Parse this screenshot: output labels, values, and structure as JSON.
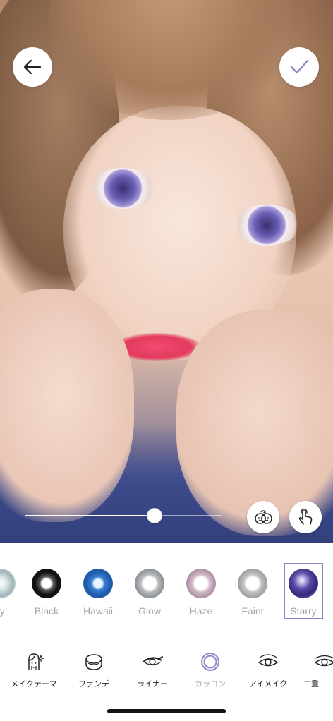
{
  "toolbar": {
    "back_icon": "arrow-left-icon",
    "confirm_icon": "checkmark-icon",
    "confirm_color": "#8e87c7"
  },
  "intensity_slider": {
    "value_fraction": 0.66
  },
  "photo_actions": {
    "compare_icon": "face-compare-icon",
    "touch_icon": "tap-hand-icon"
  },
  "lens_options": [
    {
      "label": "Pretty",
      "visible_label": "tty",
      "swatch": "sw-pretty",
      "selected": false
    },
    {
      "label": "Black",
      "swatch": "sw-black",
      "selected": false
    },
    {
      "label": "Hawaii",
      "swatch": "sw-hawaii",
      "selected": false
    },
    {
      "label": "Glow",
      "swatch": "sw-glow",
      "selected": false
    },
    {
      "label": "Haze",
      "swatch": "sw-haze",
      "selected": false
    },
    {
      "label": "Faint",
      "swatch": "sw-faint",
      "selected": false
    },
    {
      "label": "Starry",
      "swatch": "sw-starry",
      "selected": true
    }
  ],
  "colors": {
    "accent": "#8e87c7",
    "label_gray": "#a6a6a6"
  },
  "tabs": [
    {
      "label": "メイクテーマ",
      "icon": "makeup-theme-icon",
      "active": false
    },
    {
      "label": "ファンデ",
      "icon": "foundation-compact-icon",
      "active": false
    },
    {
      "label": "ライナー",
      "icon": "eyeliner-icon",
      "active": false
    },
    {
      "label": "カラコン",
      "icon": "color-contact-icon",
      "active": true
    },
    {
      "label": "アイメイク",
      "icon": "eye-makeup-icon",
      "active": false
    },
    {
      "label": "二重",
      "icon": "double-eyelid-icon",
      "active": false
    }
  ]
}
